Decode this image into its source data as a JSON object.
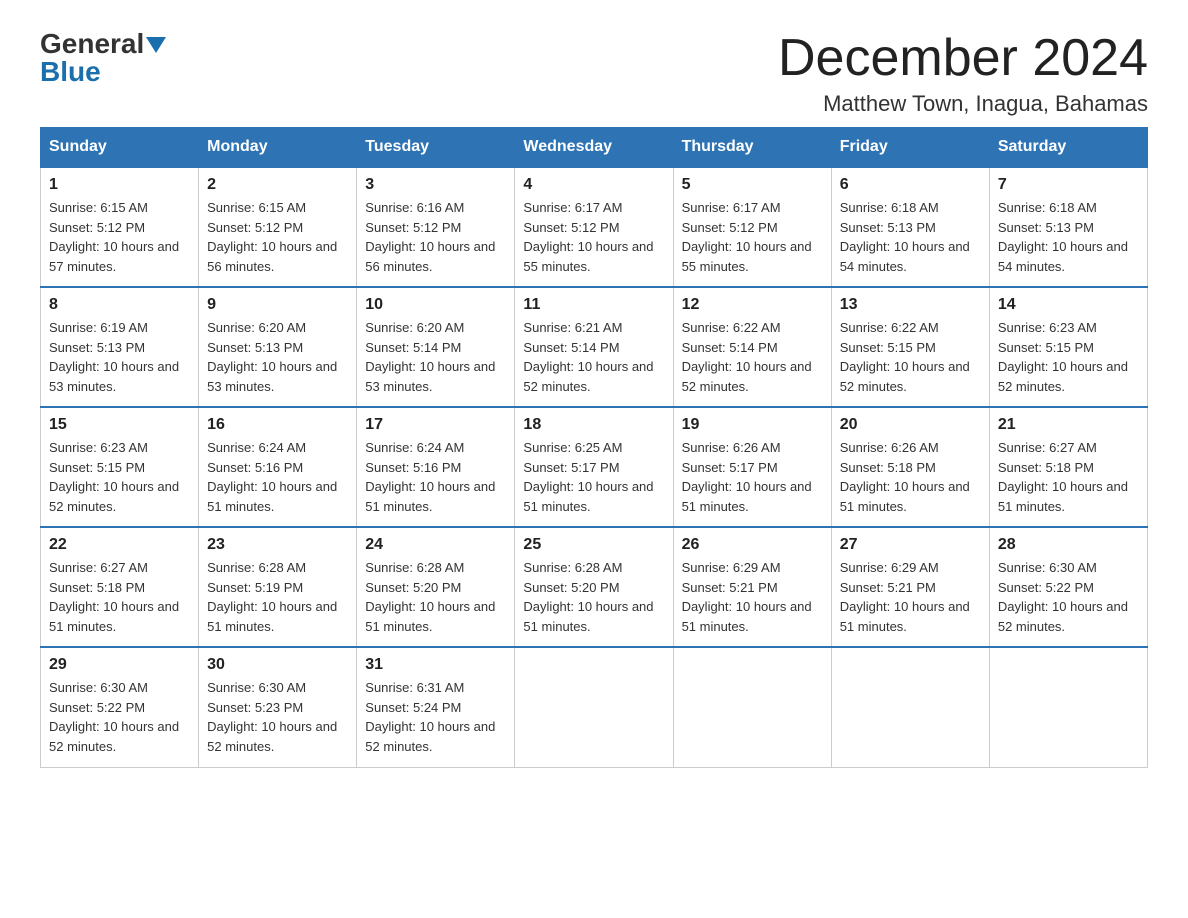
{
  "logo": {
    "general": "General",
    "blue": "Blue"
  },
  "title": "December 2024",
  "subtitle": "Matthew Town, Inagua, Bahamas",
  "days_of_week": [
    "Sunday",
    "Monday",
    "Tuesday",
    "Wednesday",
    "Thursday",
    "Friday",
    "Saturday"
  ],
  "weeks": [
    [
      {
        "num": "1",
        "sunrise": "6:15 AM",
        "sunset": "5:12 PM",
        "daylight": "10 hours and 57 minutes."
      },
      {
        "num": "2",
        "sunrise": "6:15 AM",
        "sunset": "5:12 PM",
        "daylight": "10 hours and 56 minutes."
      },
      {
        "num": "3",
        "sunrise": "6:16 AM",
        "sunset": "5:12 PM",
        "daylight": "10 hours and 56 minutes."
      },
      {
        "num": "4",
        "sunrise": "6:17 AM",
        "sunset": "5:12 PM",
        "daylight": "10 hours and 55 minutes."
      },
      {
        "num": "5",
        "sunrise": "6:17 AM",
        "sunset": "5:12 PM",
        "daylight": "10 hours and 55 minutes."
      },
      {
        "num": "6",
        "sunrise": "6:18 AM",
        "sunset": "5:13 PM",
        "daylight": "10 hours and 54 minutes."
      },
      {
        "num": "7",
        "sunrise": "6:18 AM",
        "sunset": "5:13 PM",
        "daylight": "10 hours and 54 minutes."
      }
    ],
    [
      {
        "num": "8",
        "sunrise": "6:19 AM",
        "sunset": "5:13 PM",
        "daylight": "10 hours and 53 minutes."
      },
      {
        "num": "9",
        "sunrise": "6:20 AM",
        "sunset": "5:13 PM",
        "daylight": "10 hours and 53 minutes."
      },
      {
        "num": "10",
        "sunrise": "6:20 AM",
        "sunset": "5:14 PM",
        "daylight": "10 hours and 53 minutes."
      },
      {
        "num": "11",
        "sunrise": "6:21 AM",
        "sunset": "5:14 PM",
        "daylight": "10 hours and 52 minutes."
      },
      {
        "num": "12",
        "sunrise": "6:22 AM",
        "sunset": "5:14 PM",
        "daylight": "10 hours and 52 minutes."
      },
      {
        "num": "13",
        "sunrise": "6:22 AM",
        "sunset": "5:15 PM",
        "daylight": "10 hours and 52 minutes."
      },
      {
        "num": "14",
        "sunrise": "6:23 AM",
        "sunset": "5:15 PM",
        "daylight": "10 hours and 52 minutes."
      }
    ],
    [
      {
        "num": "15",
        "sunrise": "6:23 AM",
        "sunset": "5:15 PM",
        "daylight": "10 hours and 52 minutes."
      },
      {
        "num": "16",
        "sunrise": "6:24 AM",
        "sunset": "5:16 PM",
        "daylight": "10 hours and 51 minutes."
      },
      {
        "num": "17",
        "sunrise": "6:24 AM",
        "sunset": "5:16 PM",
        "daylight": "10 hours and 51 minutes."
      },
      {
        "num": "18",
        "sunrise": "6:25 AM",
        "sunset": "5:17 PM",
        "daylight": "10 hours and 51 minutes."
      },
      {
        "num": "19",
        "sunrise": "6:26 AM",
        "sunset": "5:17 PM",
        "daylight": "10 hours and 51 minutes."
      },
      {
        "num": "20",
        "sunrise": "6:26 AM",
        "sunset": "5:18 PM",
        "daylight": "10 hours and 51 minutes."
      },
      {
        "num": "21",
        "sunrise": "6:27 AM",
        "sunset": "5:18 PM",
        "daylight": "10 hours and 51 minutes."
      }
    ],
    [
      {
        "num": "22",
        "sunrise": "6:27 AM",
        "sunset": "5:18 PM",
        "daylight": "10 hours and 51 minutes."
      },
      {
        "num": "23",
        "sunrise": "6:28 AM",
        "sunset": "5:19 PM",
        "daylight": "10 hours and 51 minutes."
      },
      {
        "num": "24",
        "sunrise": "6:28 AM",
        "sunset": "5:20 PM",
        "daylight": "10 hours and 51 minutes."
      },
      {
        "num": "25",
        "sunrise": "6:28 AM",
        "sunset": "5:20 PM",
        "daylight": "10 hours and 51 minutes."
      },
      {
        "num": "26",
        "sunrise": "6:29 AM",
        "sunset": "5:21 PM",
        "daylight": "10 hours and 51 minutes."
      },
      {
        "num": "27",
        "sunrise": "6:29 AM",
        "sunset": "5:21 PM",
        "daylight": "10 hours and 51 minutes."
      },
      {
        "num": "28",
        "sunrise": "6:30 AM",
        "sunset": "5:22 PM",
        "daylight": "10 hours and 52 minutes."
      }
    ],
    [
      {
        "num": "29",
        "sunrise": "6:30 AM",
        "sunset": "5:22 PM",
        "daylight": "10 hours and 52 minutes."
      },
      {
        "num": "30",
        "sunrise": "6:30 AM",
        "sunset": "5:23 PM",
        "daylight": "10 hours and 52 minutes."
      },
      {
        "num": "31",
        "sunrise": "6:31 AM",
        "sunset": "5:24 PM",
        "daylight": "10 hours and 52 minutes."
      },
      null,
      null,
      null,
      null
    ]
  ]
}
